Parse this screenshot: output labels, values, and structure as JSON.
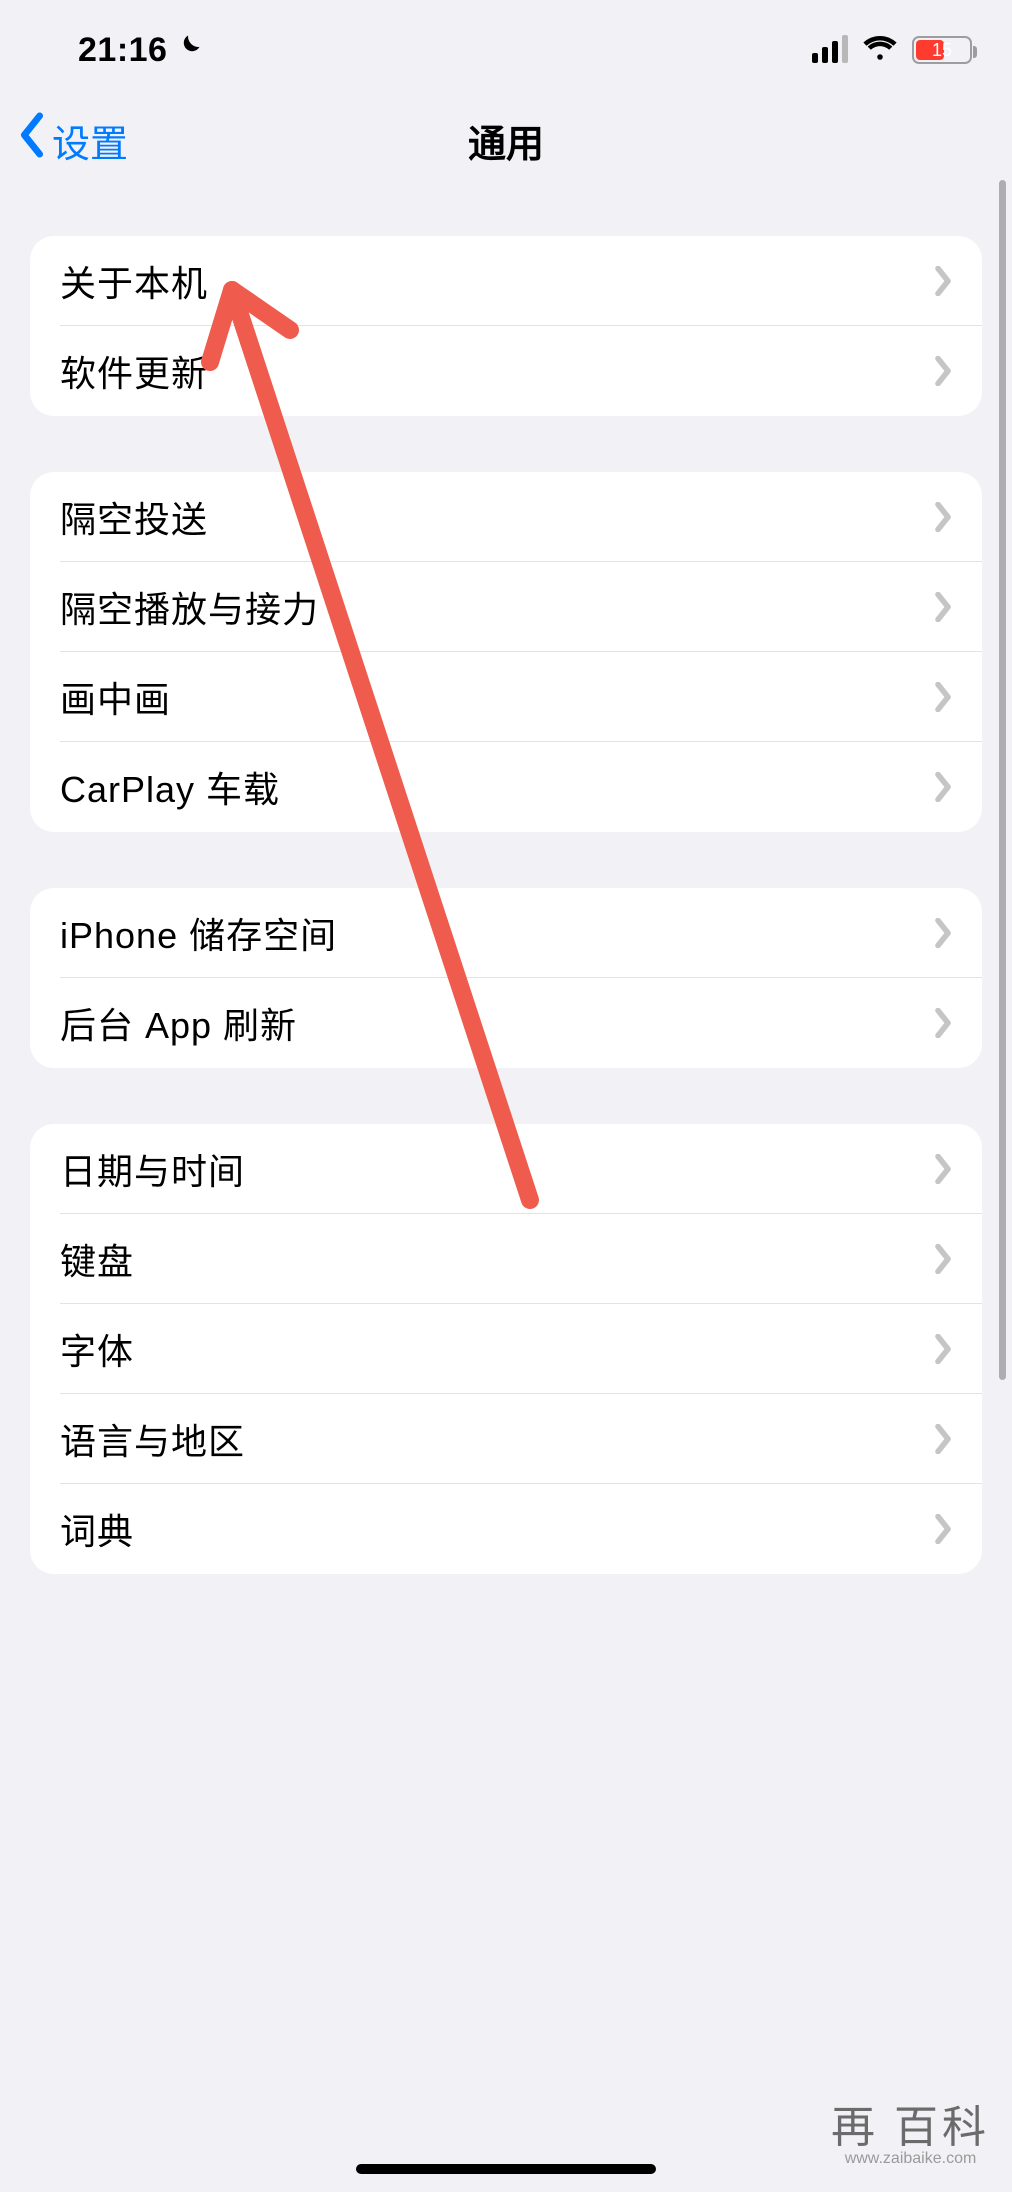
{
  "status": {
    "time": "21:16",
    "dnd_icon": "moon",
    "battery_percent": "15",
    "battery_color": "#ff3b30"
  },
  "nav": {
    "back_label": "设置",
    "title": "通用"
  },
  "groups": [
    {
      "rows": [
        {
          "label": "关于本机"
        },
        {
          "label": "软件更新"
        }
      ]
    },
    {
      "rows": [
        {
          "label": "隔空投送"
        },
        {
          "label": "隔空播放与接力"
        },
        {
          "label": "画中画"
        },
        {
          "label": "CarPlay 车载"
        }
      ]
    },
    {
      "rows": [
        {
          "label": "iPhone 储存空间"
        },
        {
          "label": "后台 App 刷新"
        }
      ]
    },
    {
      "rows": [
        {
          "label": "日期与时间"
        },
        {
          "label": "键盘"
        },
        {
          "label": "字体"
        },
        {
          "label": "语言与地区"
        },
        {
          "label": "词典"
        }
      ]
    }
  ],
  "annotation": {
    "type": "arrow",
    "color": "#ef5b4c"
  },
  "watermark": {
    "line1": "再 百科",
    "line2": "www.zaibaike.com"
  }
}
